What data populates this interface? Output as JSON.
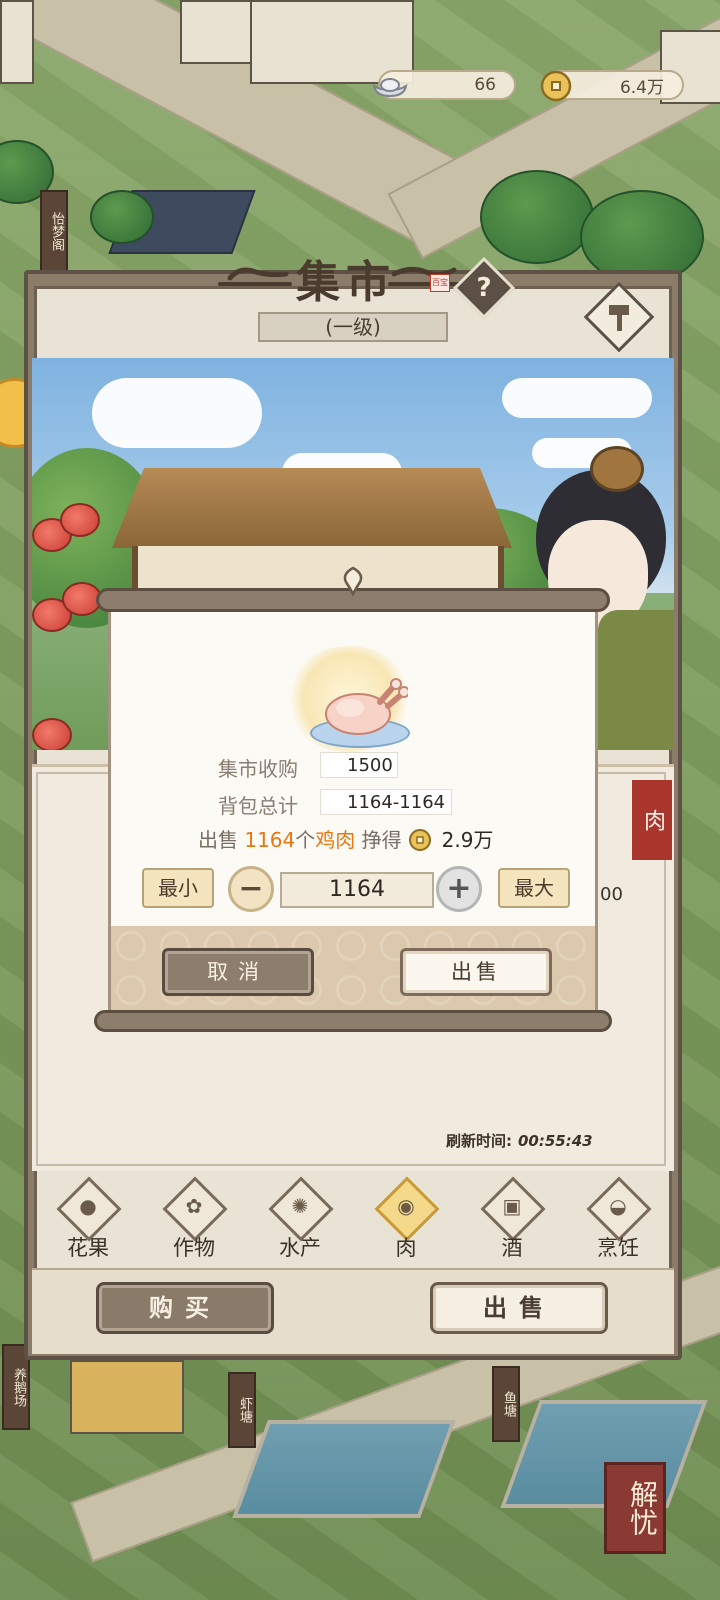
{
  "currency": {
    "silver": "66",
    "copper": "6.4万"
  },
  "panel": {
    "title": "集市",
    "seal": "百宝",
    "level": "(一级)",
    "help_glyph": "?"
  },
  "world_signs": [
    "怡梦阁",
    "养鹅场",
    "虾塘",
    "鱼塘"
  ],
  "list": {
    "category_tag": "肉",
    "partial_value": "00",
    "refresh_label": "刷新时间:",
    "refresh_time": "00:55:43"
  },
  "dialog": {
    "market_buy_label": "集市收购",
    "market_buy_value": "1500",
    "bag_total_label": "背包总计",
    "bag_total_value": "1164-1164",
    "sell_prefix": "出售",
    "sell_count": "1164",
    "sell_unit": "个",
    "sell_item": "鸡肉",
    "earn_label": "挣得",
    "earn_value": "2.9万",
    "min_label": "最小",
    "max_label": "最大",
    "quantity": "1164",
    "cancel_label": "取消",
    "confirm_label": "出售"
  },
  "tabs": [
    {
      "label": "花果",
      "icon": "fruit-icon"
    },
    {
      "label": "作物",
      "icon": "wheat-icon"
    },
    {
      "label": "水产",
      "icon": "crab-icon"
    },
    {
      "label": "肉",
      "icon": "meat-icon",
      "active": true
    },
    {
      "label": "酒",
      "icon": "wine-jar-icon"
    },
    {
      "label": "烹饪",
      "icon": "dish-cover-icon"
    }
  ],
  "bottom": {
    "buy_label": "购买",
    "sell_label": "出售"
  },
  "corner_seal": "解忧"
}
